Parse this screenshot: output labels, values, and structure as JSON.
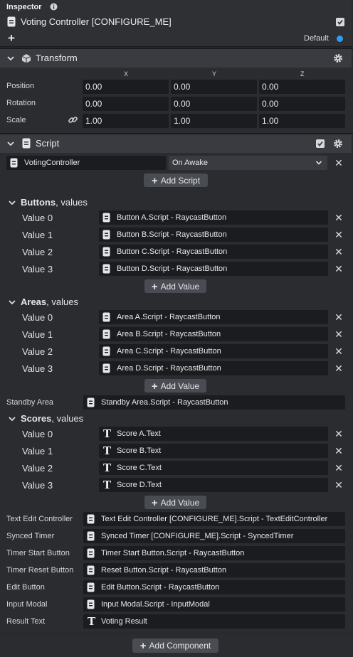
{
  "inspector": {
    "title": "Inspector",
    "object_name": "Voting Controller [CONFIGURE_ME]",
    "layer": "Default"
  },
  "transform": {
    "title": "Transform",
    "axes": [
      "X",
      "Y",
      "Z"
    ],
    "rows": [
      {
        "label": "Position",
        "values": [
          "0.00",
          "0.00",
          "0.00"
        ]
      },
      {
        "label": "Rotation",
        "values": [
          "0.00",
          "0.00",
          "0.00"
        ]
      },
      {
        "label": "Scale",
        "values": [
          "1.00",
          "1.00",
          "1.00"
        ]
      }
    ]
  },
  "script": {
    "title": "Script",
    "asset": "VotingController",
    "event": "On Awake",
    "add_script": "Add Script"
  },
  "groups": {
    "buttons": {
      "name": "Buttons",
      "suffix": ", values",
      "items": [
        {
          "label": "Value 0",
          "ref": "Button A.Script - RaycastButton"
        },
        {
          "label": "Value 1",
          "ref": "Button B.Script - RaycastButton"
        },
        {
          "label": "Value 2",
          "ref": "Button C.Script - RaycastButton"
        },
        {
          "label": "Value 3",
          "ref": "Button D.Script - RaycastButton"
        }
      ],
      "add_label": "Add Value"
    },
    "areas": {
      "name": "Areas",
      "suffix": ", values",
      "items": [
        {
          "label": "Value 0",
          "ref": "Area A.Script - RaycastButton"
        },
        {
          "label": "Value 1",
          "ref": "Area B.Script - RaycastButton"
        },
        {
          "label": "Value 2",
          "ref": "Area C.Script - RaycastButton"
        },
        {
          "label": "Value 3",
          "ref": "Area D.Script - RaycastButton"
        }
      ],
      "add_label": "Add Value"
    },
    "scores": {
      "name": "Scores",
      "suffix": ", values",
      "items": [
        {
          "label": "Value 0",
          "ref": "Score A.Text"
        },
        {
          "label": "Value 1",
          "ref": "Score B.Text"
        },
        {
          "label": "Value 2",
          "ref": "Score C.Text"
        },
        {
          "label": "Value 3",
          "ref": "Score D.Text"
        }
      ],
      "add_label": "Add Value"
    }
  },
  "standby": {
    "label": "Standby Area",
    "ref": "Standby Area.Script - RaycastButton"
  },
  "props": [
    {
      "label": "Text Edit Controller",
      "ref": "Text Edit Controller [CONFIGURE_ME].Script - TextEditController",
      "icon": "script-icon"
    },
    {
      "label": "Synced Timer",
      "ref": "Synced Timer [CONFIGURE_ME].Script - SyncedTimer",
      "icon": "script-icon"
    },
    {
      "label": "Timer Start Button",
      "ref": "Timer Start Button.Script - RaycastButton",
      "icon": "script-icon"
    },
    {
      "label": "Timer Reset Button",
      "ref": "Reset Button.Script - RaycastButton",
      "icon": "script-icon"
    },
    {
      "label": "Edit Button",
      "ref": "Edit Button.Script - RaycastButton",
      "icon": "script-icon"
    },
    {
      "label": "Input Modal",
      "ref": "Input Modal.Script - InputModal",
      "icon": "script-icon"
    },
    {
      "label": "Result Text",
      "ref": "Voting Result",
      "icon": "text-icon"
    }
  ],
  "add_component": "Add Component",
  "colors": {
    "accent": "#2f9cf4",
    "panel": "#2b2c30",
    "field": "#1b1c1f",
    "button": "#4a4c53"
  }
}
